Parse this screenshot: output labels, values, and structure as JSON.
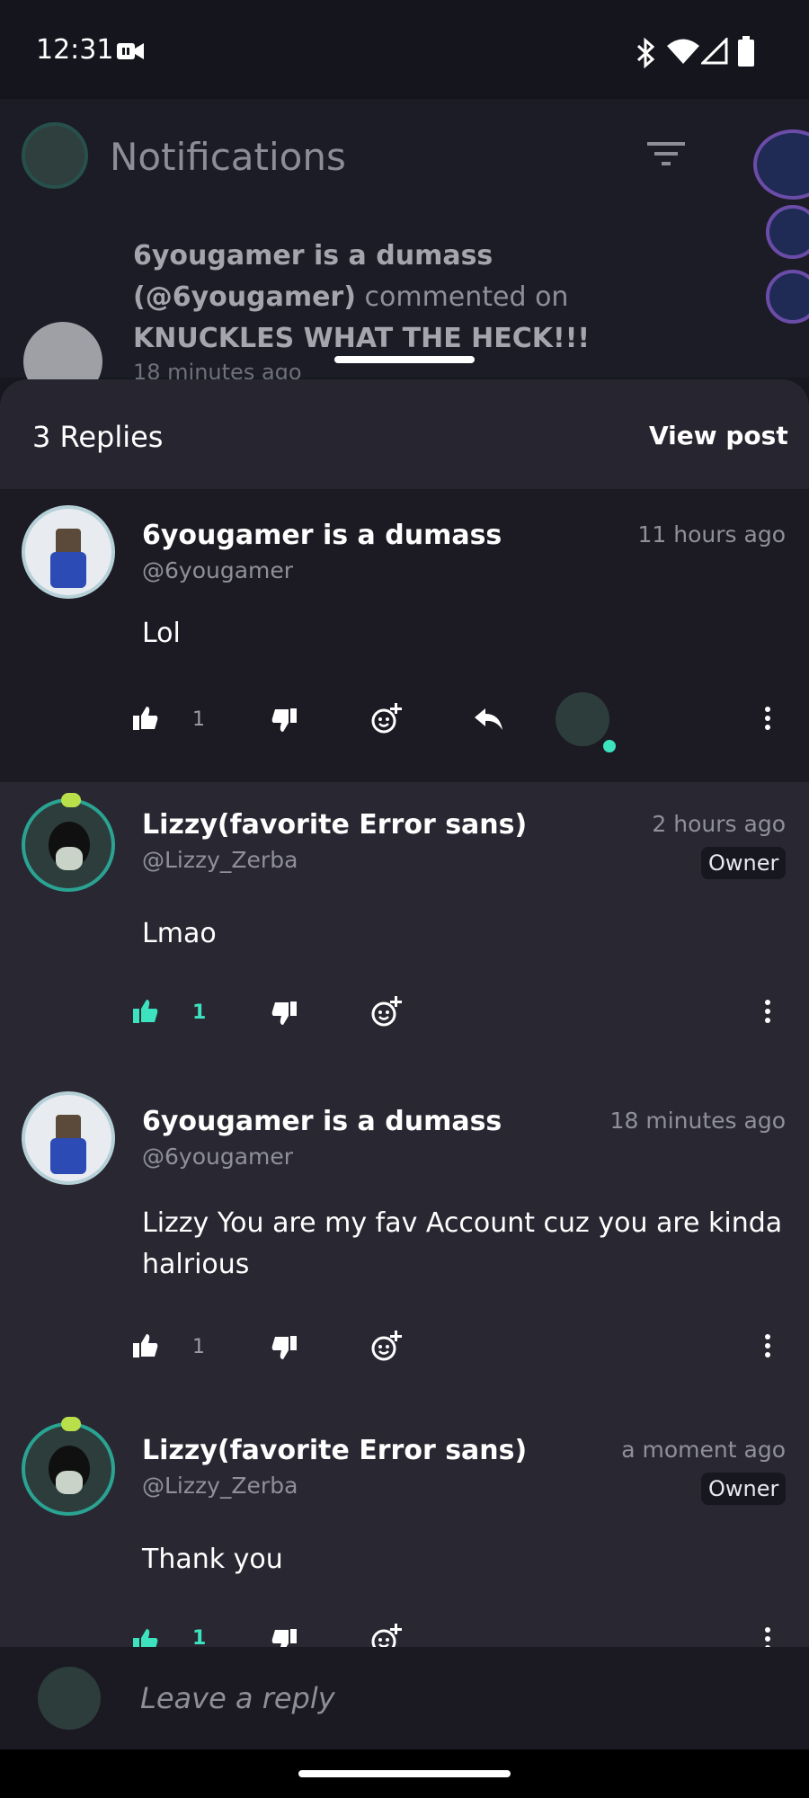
{
  "status": {
    "time": "12:31"
  },
  "background": {
    "title": "Notifications",
    "notification": {
      "author": "6yougamer is a dumass (@6yougamer)",
      "action": "commented on",
      "post": "KNUCKLES WHAT THE HECK!!!",
      "time": "18 minutes ago"
    }
  },
  "sheet": {
    "replies_count": "3 Replies",
    "view_post": "View post"
  },
  "comments": [
    {
      "name": "6yougamer is a dumass",
      "handle": "@6yougamer",
      "time": "11 hours ago",
      "text": "Lol",
      "likes": "1",
      "liked": false
    },
    {
      "name": "Lizzy(favorite Error sans)",
      "handle": "@Lizzy_Zerba",
      "time": "2 hours ago",
      "badge": "Owner",
      "text": "Lmao",
      "likes": "1",
      "liked": true
    },
    {
      "name": "6yougamer is a dumass",
      "handle": "@6yougamer",
      "time": "18 minutes ago",
      "text": "Lizzy You are my fav Account cuz you are kinda halrious",
      "likes": "1",
      "liked": false
    },
    {
      "name": "Lizzy(favorite Error sans)",
      "handle": "@Lizzy_Zerba",
      "time": "a moment ago",
      "badge": "Owner",
      "text": "Thank you",
      "likes": "1",
      "liked": true
    }
  ],
  "reply_input": {
    "placeholder": "Leave a reply"
  },
  "colors": {
    "accent": "#3de3bf",
    "sheet_bg": "#22212b",
    "header_bg": "#272630"
  },
  "icons": [
    "camera-recording-icon",
    "bluetooth-icon",
    "wifi-icon",
    "signal-icon",
    "battery-icon",
    "filter-icon",
    "like-icon",
    "dislike-icon",
    "add-reaction-icon",
    "reply-icon",
    "more-vertical-icon"
  ]
}
